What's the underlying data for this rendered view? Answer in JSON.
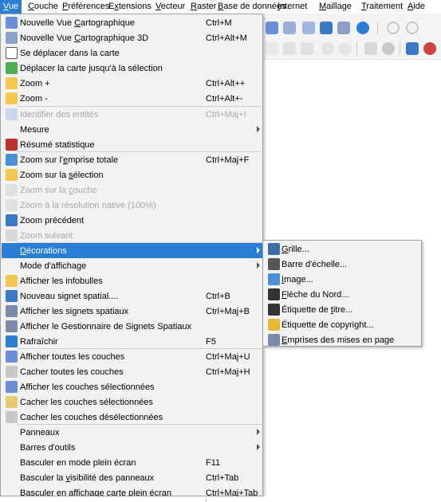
{
  "menubar": {
    "items": [
      {
        "pre": "",
        "u": "V",
        "post": "ue"
      },
      {
        "pre": "",
        "u": "C",
        "post": "ouche"
      },
      {
        "pre": "",
        "u": "P",
        "post": "références"
      },
      {
        "pre": "E",
        "u": "x",
        "post": "tensions"
      },
      {
        "pre": "",
        "u": "V",
        "post": "ecteur"
      },
      {
        "pre": "",
        "u": "R",
        "post": "aster"
      },
      {
        "pre": "",
        "u": "B",
        "post": "ase de données"
      },
      {
        "pre": "",
        "u": "I",
        "post": "nternet"
      },
      {
        "pre": "",
        "u": "M",
        "post": "aillage"
      },
      {
        "pre": "",
        "u": "T",
        "post": "raitement"
      },
      {
        "pre": "",
        "u": "A",
        "post": "ide"
      }
    ]
  },
  "menu": {
    "items": [
      {
        "icon": "new-map-view-icon",
        "color": "#6a8fd8",
        "pre": "Nouvelle Vue ",
        "u": "C",
        "post": "artographique",
        "shortcut": "Ctrl+M"
      },
      {
        "icon": "new-3d-map-view-icon",
        "color": "#8aa0c8",
        "pre": "Nouvelle Vue ",
        "u": "C",
        "post": "artographique 3D",
        "shortcut": "Ctrl+Alt+M"
      },
      {
        "icon": "pan-hand-icon",
        "color": "#ffffff",
        "pre": "Se déplacer dans la carte",
        "u": "",
        "post": "",
        "shortcut": ""
      },
      {
        "icon": "pan-to-selection-icon",
        "color": "#4caf50",
        "pre": "Déplacer la carte jusqu'à la sélection",
        "u": "",
        "post": "",
        "shortcut": ""
      },
      {
        "icon": "zoom-in-icon",
        "color": "#f2c94c",
        "pre": "Zoom +",
        "u": "",
        "post": "",
        "shortcut": "Ctrl+Alt++"
      },
      {
        "icon": "zoom-out-icon",
        "color": "#f2c94c",
        "pre": "Zoom -",
        "u": "",
        "post": "",
        "shortcut": "Ctrl+Alt+-"
      },
      {
        "icon": "identify-features-icon",
        "color": "#c8d8f0",
        "pre": "Identifier des entités",
        "u": "",
        "post": "",
        "shortcut": "Ctrl+Maj+I"
      },
      {
        "icon": "",
        "color": "",
        "pre": "Mesure",
        "u": "",
        "post": "",
        "shortcut": ""
      },
      {
        "icon": "sigma-statistics-icon",
        "color": "#c0302a",
        "pre": "Résumé statistique",
        "u": "",
        "post": "",
        "shortcut": ""
      },
      {
        "icon": "zoom-full-extent-icon",
        "color": "#4a90d9",
        "pre": "Zoom sur l'",
        "u": "e",
        "post": "mprise totale",
        "shortcut": "Ctrl+Maj+F"
      },
      {
        "icon": "zoom-to-selection-icon",
        "color": "#f2c94c",
        "pre": "Zoom sur la ",
        "u": "s",
        "post": "élection",
        "shortcut": ""
      },
      {
        "icon": "zoom-to-layer-icon",
        "color": "#e0e0e0",
        "pre": "Zoom sur la ",
        "u": "c",
        "post": "ouche",
        "shortcut": ""
      },
      {
        "icon": "zoom-native-resolution-icon",
        "color": "#e0e0e0",
        "pre": "Zoom à la résolution native (100%)",
        "u": "",
        "post": "",
        "shortcut": ""
      },
      {
        "icon": "zoom-previous-icon",
        "color": "#3a78c8",
        "pre": "Zoom précédent",
        "u": "",
        "post": "",
        "shortcut": ""
      },
      {
        "icon": "zoom-next-icon",
        "color": "#d8d8d8",
        "pre": "Zoom suivant",
        "u": "",
        "post": "",
        "shortcut": ""
      },
      {
        "icon": "",
        "color": "",
        "pre": "",
        "u": "D",
        "post": "écorations",
        "shortcut": ""
      },
      {
        "icon": "",
        "color": "",
        "pre": "Mode d'affichage",
        "u": "",
        "post": "",
        "shortcut": ""
      },
      {
        "icon": "map-tips-icon",
        "color": "#f2c94c",
        "pre": "Afficher les infobulles",
        "u": "",
        "post": "",
        "shortcut": ""
      },
      {
        "icon": "new-bookmark-icon",
        "color": "#3a78c8",
        "pre": "Nouveau signet spatial....",
        "u": "",
        "post": "",
        "shortcut": "Ctrl+B"
      },
      {
        "icon": "show-bookmarks-icon",
        "color": "#7a8aa8",
        "pre": "Afficher les signets spatiaux",
        "u": "",
        "post": "",
        "shortcut": "Ctrl+Maj+B"
      },
      {
        "icon": "bookmark-manager-icon",
        "color": "#7a8aa8",
        "pre": "Afficher le Gestionnaire de Signets Spatiaux",
        "u": "",
        "post": "",
        "shortcut": ""
      },
      {
        "icon": "refresh-icon",
        "color": "#2a7fd4",
        "pre": "Rafraîchir",
        "u": "",
        "post": "",
        "shortcut": "F5"
      },
      {
        "icon": "show-all-layers-icon",
        "color": "#6a8fd8",
        "pre": "Afficher toutes les couches",
        "u": "",
        "post": "",
        "shortcut": "Ctrl+Maj+U"
      },
      {
        "icon": "hide-all-layers-icon",
        "color": "#c8c8c8",
        "pre": "Cacher toutes les couches",
        "u": "",
        "post": "",
        "shortcut": "Ctrl+Maj+H"
      },
      {
        "icon": "show-selected-layers-icon",
        "color": "#6a8fd8",
        "pre": "Afficher les couches sélectionnées",
        "u": "",
        "post": "",
        "shortcut": ""
      },
      {
        "icon": "hide-selected-layers-icon",
        "color": "#e8c870",
        "pre": "Cacher les couches sélectionnées",
        "u": "",
        "post": "",
        "shortcut": ""
      },
      {
        "icon": "hide-deselected-layers-icon",
        "color": "#c8c8c8",
        "pre": "Cacher les couches désélectionnées",
        "u": "",
        "post": "",
        "shortcut": ""
      },
      {
        "icon": "",
        "color": "",
        "pre": "Panneaux",
        "u": "",
        "post": "",
        "shortcut": ""
      },
      {
        "icon": "",
        "color": "",
        "pre": "Barres d'outils",
        "u": "",
        "post": "",
        "shortcut": ""
      },
      {
        "icon": "",
        "color": "",
        "pre": "Basculer en mode plein écran",
        "u": "",
        "post": "",
        "shortcut": "F11"
      },
      {
        "icon": "",
        "color": "",
        "pre": "Basculer la ",
        "u": "v",
        "post": "isibilité des panneaux",
        "shortcut": "Ctrl+Tab"
      },
      {
        "icon": "",
        "color": "",
        "pre": "Basculer en affichage carte plein écran",
        "u": "",
        "post": "",
        "shortcut": "Ctrl+Maj+Tab"
      }
    ]
  },
  "submenu": {
    "items": [
      {
        "icon": "grid-icon",
        "color": "#3a6ea8",
        "pre": "",
        "u": "G",
        "post": "rille..."
      },
      {
        "icon": "scale-bar-icon",
        "color": "#555555",
        "pre": "Barre d'échelle...",
        "u": "",
        "post": ""
      },
      {
        "icon": "image-icon",
        "color": "#4a90d9",
        "pre": "",
        "u": "I",
        "post": "mage..."
      },
      {
        "icon": "north-arrow-icon",
        "color": "#333333",
        "pre": "",
        "u": "F",
        "post": "lèche du Nord..."
      },
      {
        "icon": "title-label-icon",
        "color": "#333333",
        "pre": "Étiquette de ",
        "u": "t",
        "post": "itre..."
      },
      {
        "icon": "copyright-label-icon",
        "color": "#e8b830",
        "pre": "Étiquette de copyright...",
        "u": "",
        "post": ""
      },
      {
        "icon": "layout-extents-icon",
        "color": "#7a8aa8",
        "pre": "",
        "u": "E",
        "post": "mprises des mises en page"
      }
    ]
  },
  "colors": {
    "highlight": "#2a7fd4",
    "menu_bg": "#f2f2f2",
    "disabled_text": "#a8a8a8"
  }
}
